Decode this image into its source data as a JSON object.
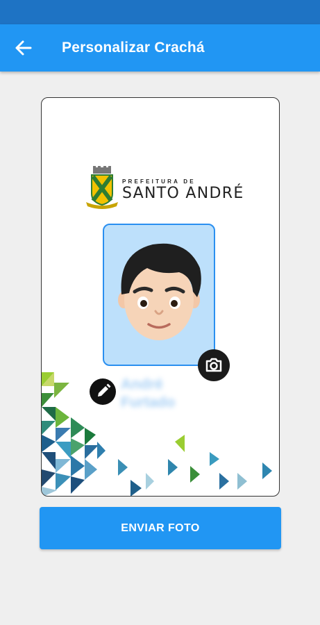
{
  "header": {
    "title": "Personalizar Crachá",
    "back_icon": "arrow-left-icon"
  },
  "badge": {
    "logo": {
      "small_text": "PREFEITURA DE",
      "big_text": "SANTO ANDRÉ"
    },
    "name": [
      "André",
      "Furtado"
    ],
    "camera_icon": "camera-icon",
    "edit_icon": "pencil-icon"
  },
  "actions": {
    "send_label": "ENVIAR FOTO"
  },
  "colors": {
    "primary": "#2196f3",
    "status_bar": "#1e73c4",
    "photo_bg": "#bde0fb"
  }
}
